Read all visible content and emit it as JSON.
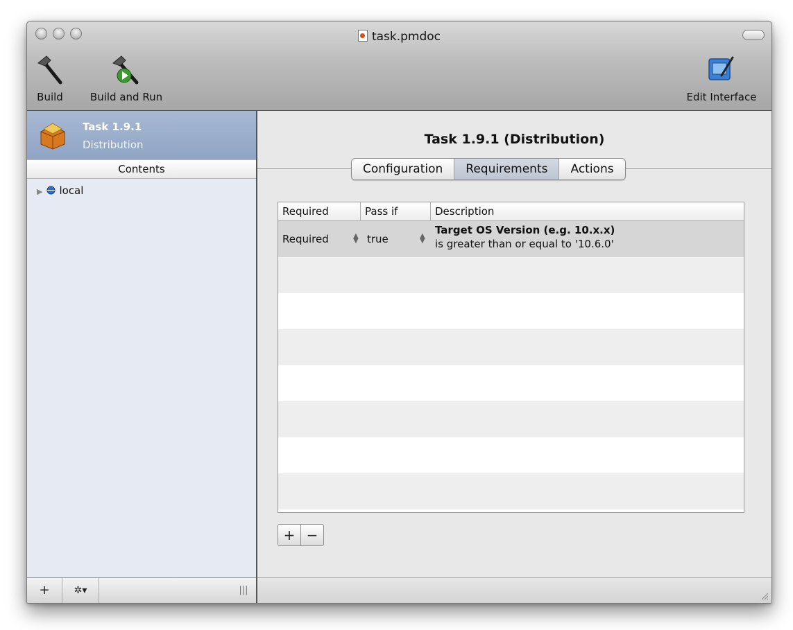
{
  "window": {
    "title": "task.pmdoc"
  },
  "toolbar": {
    "build_label": "Build",
    "build_and_run_label": "Build and Run",
    "edit_interface_label": "Edit Interface"
  },
  "sidebar": {
    "selected_item": {
      "title": "Task 1.9.1",
      "subtitle": "Distribution",
      "icon": "package-icon"
    },
    "contents_header": "Contents",
    "tree": [
      {
        "label": "local",
        "icon": "globe-icon"
      }
    ],
    "footer": {
      "add_label": "+",
      "action_label": "✲▾",
      "resize_label": "|||"
    }
  },
  "main": {
    "title": "Task 1.9.1 (Distribution)",
    "tabs": [
      {
        "label": "Configuration",
        "active": false
      },
      {
        "label": "Requirements",
        "active": true
      },
      {
        "label": "Actions",
        "active": false
      }
    ],
    "table": {
      "columns": [
        "Required",
        "Pass if",
        "Description"
      ],
      "rows": [
        {
          "required": "Required",
          "pass_if": "true",
          "description_title": "Target OS Version (e.g. 10.x.x)",
          "description_detail": "is greater than or equal to '10.6.0'"
        }
      ]
    },
    "add_label": "+",
    "remove_label": "−"
  },
  "colors": {
    "selection": "#95a9c7",
    "zebra": "#eeeeee",
    "selected_row": "#d6d6d6",
    "close_dot": "#d2501a"
  }
}
